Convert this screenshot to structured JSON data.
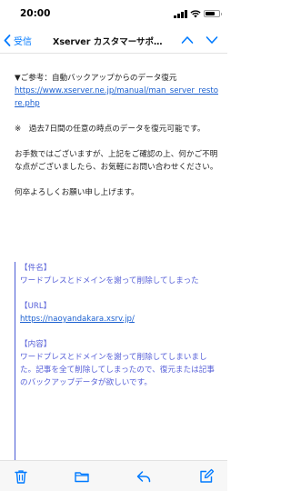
{
  "status": {
    "time": "20:00"
  },
  "nav": {
    "back_label": "受信",
    "title": "Xserver カスタマーサポ…"
  },
  "email": {
    "ref_label": "▼ご参考：自動バックアップからのデータ復元",
    "ref_link": "https://www.xserver.ne.jp/manual/man_server_restore.php",
    "note": "※　過去7日間の任意の時点のデータを復元可能です。",
    "para1": "お手数ではございますが、上記をご確認の上、何かご不明な点がございましたら、お気軽にお問い合わせください。",
    "para2": "何卒よろしくお願い申し上げます。"
  },
  "quote": {
    "subject_label": "【件名】",
    "subject_value": "ワードプレスとドメインを謝って削除してしまった",
    "url_label": "【URL】",
    "url_value": "https://naoyandakara.xsrv.jp/",
    "content_label": "【内容】",
    "content_value": "ワードプレスとドメインを謝って削除してしまいました。記事を全て削除してしまったので、復元または記事のバックアップデータが欲しいです。"
  },
  "colors": {
    "accent": "#007aff",
    "link": "#1a5fd0",
    "quote": "#5760d8"
  }
}
